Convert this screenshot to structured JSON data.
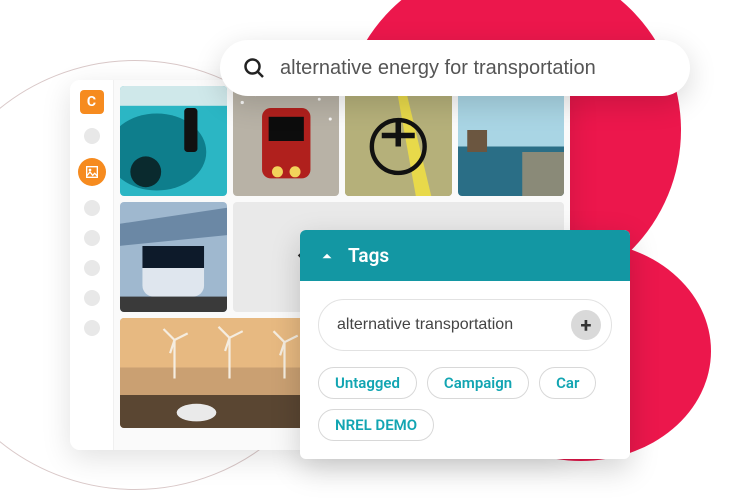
{
  "search": {
    "value": "alternative energy for transportation"
  },
  "tags_panel": {
    "title": "Tags",
    "input_value": "alternative transportation",
    "chips": [
      "Untagged",
      "Campaign",
      "Car",
      "NREL DEMO"
    ]
  },
  "sidebar": {
    "logo_letter": "C"
  },
  "colors": {
    "accent_pink": "#ec174c",
    "accent_orange": "#f68b1f",
    "accent_teal": "#1397a3",
    "chip_text": "#12a5b2"
  }
}
